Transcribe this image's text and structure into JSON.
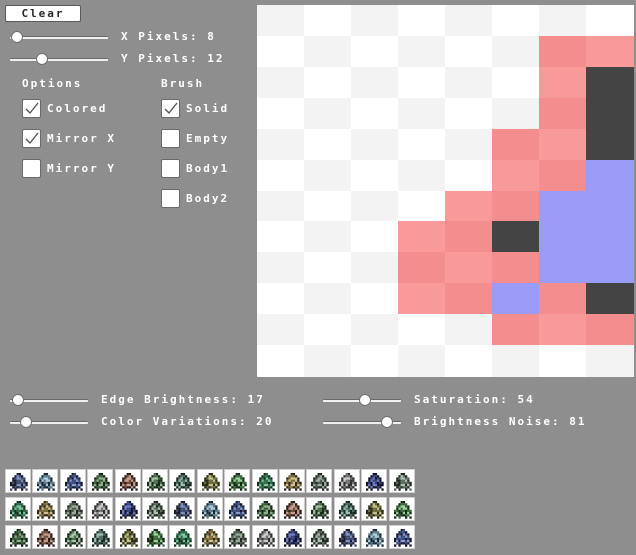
{
  "toolbar": {
    "clear_label": "Clear"
  },
  "pixels": {
    "x_label": "X Pixels: 8",
    "y_label": "Y Pixels: 12",
    "x_value": 8,
    "y_value": 12
  },
  "options": {
    "heading": "Options",
    "items": [
      {
        "label": "Colored",
        "checked": true
      },
      {
        "label": "Mirror X",
        "checked": true
      },
      {
        "label": "Mirror Y",
        "checked": false
      }
    ]
  },
  "brush": {
    "heading": "Brush",
    "items": [
      {
        "label": "Solid",
        "checked": true
      },
      {
        "label": "Empty",
        "checked": false
      },
      {
        "label": "Body1",
        "checked": false
      },
      {
        "label": "Body2",
        "checked": false
      }
    ]
  },
  "params": {
    "edge_brightness_label": "Edge Brightness: 17",
    "color_variations_label": "Color Variations: 20",
    "saturation_label": "Saturation: 54",
    "brightness_noise_label": "Brightness Noise: 81",
    "edge_brightness": 17,
    "color_variations": 20,
    "saturation": 54,
    "brightness_noise": 81
  },
  "colors": {
    "background": "#8e8e8e",
    "empty_light": "#f3f3f3",
    "empty_white": "#ffffff",
    "body1": "#f99a9a",
    "body1_alt": "#f48e8e",
    "body2": "#9a9cf8",
    "solid": "#444444"
  },
  "grid": {
    "cols": 8,
    "rows": 12,
    "cells": [
      [
        "E",
        "E",
        "E",
        "E",
        "E",
        "E",
        "E",
        "E"
      ],
      [
        "E",
        "E",
        "E",
        "E",
        "E",
        "E",
        "B1",
        "B1"
      ],
      [
        "E",
        "E",
        "E",
        "E",
        "E",
        "E",
        "B1",
        "S"
      ],
      [
        "E",
        "E",
        "E",
        "E",
        "E",
        "E",
        "B1",
        "S"
      ],
      [
        "E",
        "E",
        "E",
        "E",
        "E",
        "B1",
        "B1",
        "S"
      ],
      [
        "E",
        "E",
        "E",
        "E",
        "E",
        "B1",
        "B1",
        "B2"
      ],
      [
        "E",
        "E",
        "E",
        "E",
        "B1",
        "B1",
        "B2",
        "B2"
      ],
      [
        "E",
        "E",
        "E",
        "B1",
        "B1",
        "S",
        "B2",
        "B2"
      ],
      [
        "E",
        "E",
        "E",
        "B1",
        "B1",
        "B1",
        "B2",
        "B2"
      ],
      [
        "E",
        "E",
        "E",
        "B1",
        "B1",
        "B2",
        "B1",
        "S"
      ],
      [
        "E",
        "E",
        "E",
        "E",
        "E",
        "B1",
        "B1",
        "B1"
      ],
      [
        "E",
        "E",
        "E",
        "E",
        "E",
        "E",
        "E",
        "E"
      ]
    ]
  },
  "gallery": {
    "rows": 3,
    "cols": 15,
    "count": 45
  }
}
